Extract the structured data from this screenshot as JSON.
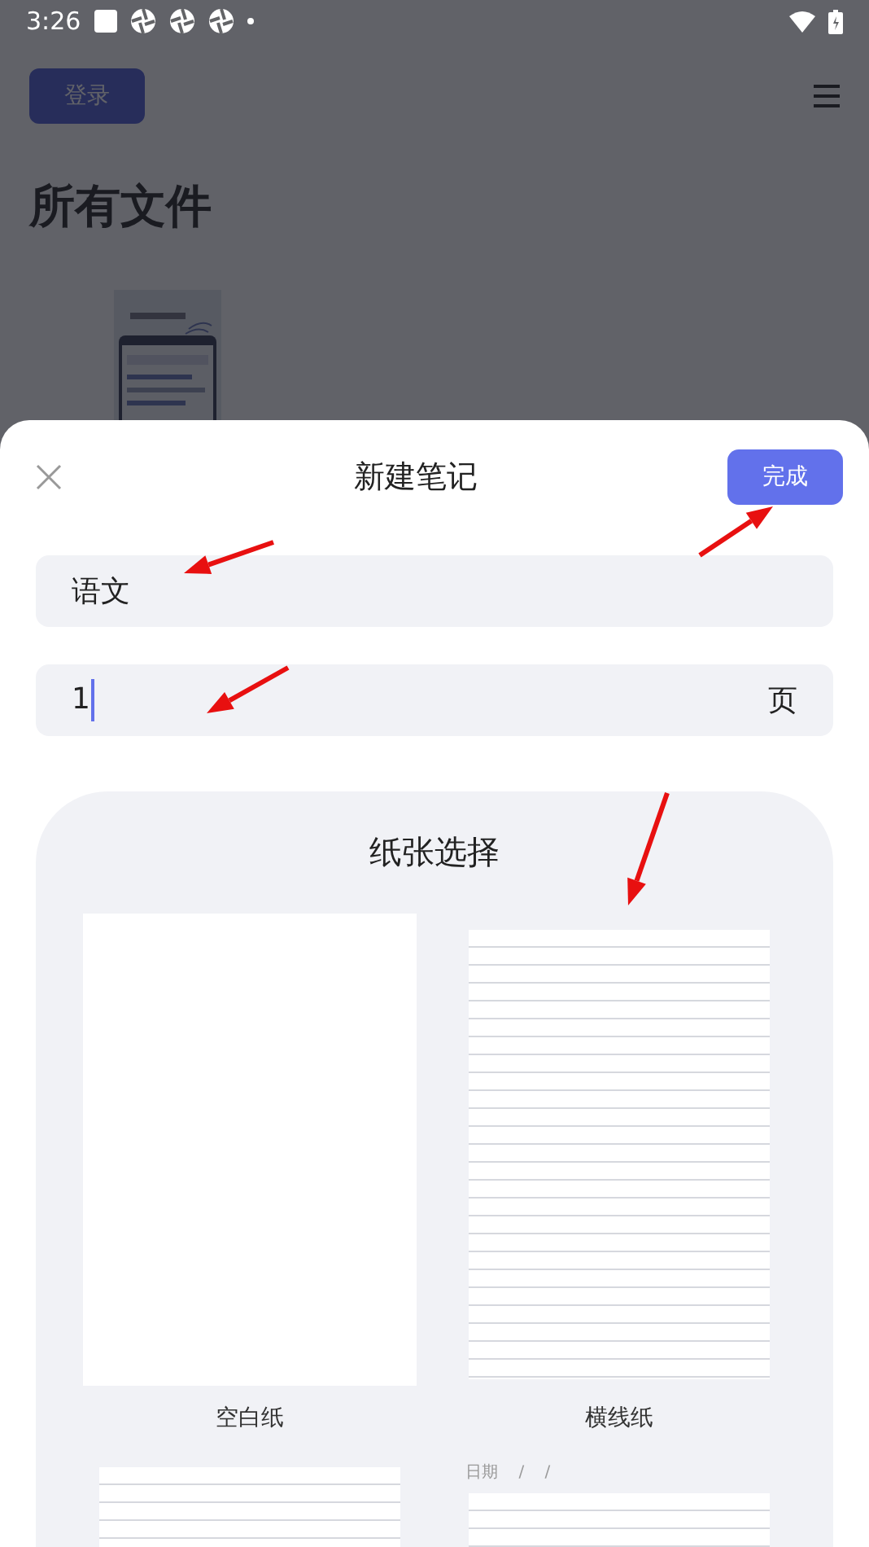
{
  "status_bar": {
    "time": "3:26"
  },
  "background_page": {
    "login_button": "登录",
    "title": "所有文件"
  },
  "dialog": {
    "title": "新建笔记",
    "done_button": "完成",
    "fields": [
      {
        "value": "语文",
        "focused": false
      },
      {
        "value": "1",
        "suffix": "页",
        "focused": true
      }
    ],
    "paper_picker": {
      "title": "纸张选择",
      "papers": [
        {
          "kind": "blank",
          "label": "空白纸"
        },
        {
          "kind": "lined",
          "label": "横线纸"
        },
        {
          "kind": "lined"
        },
        {
          "kind": "dated",
          "header": "日期    /    /"
        }
      ]
    }
  }
}
